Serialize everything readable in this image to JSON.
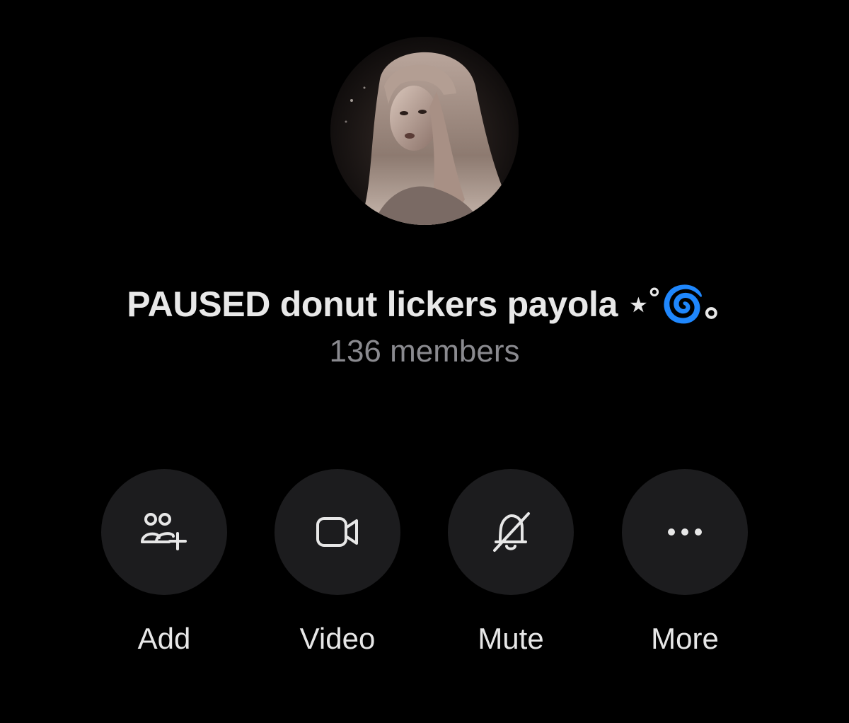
{
  "group": {
    "name": "PAUSED donut lickers payola ⋆˚🌀｡",
    "members": "136 members"
  },
  "avatar": {
    "icon": "group-avatar-photo"
  },
  "actions": [
    {
      "label": "Add",
      "icon": "add-people-icon"
    },
    {
      "label": "Video",
      "icon": "video-camera-icon"
    },
    {
      "label": "Mute",
      "icon": "bell-slash-icon"
    },
    {
      "label": "More",
      "icon": "ellipsis-icon"
    }
  ],
  "colors": {
    "background": "#000000",
    "button_background": "#1c1c1e",
    "title_text": "#e8e8e8",
    "subtitle_text": "#8a8a8f",
    "label_text": "#e7e7e7"
  }
}
